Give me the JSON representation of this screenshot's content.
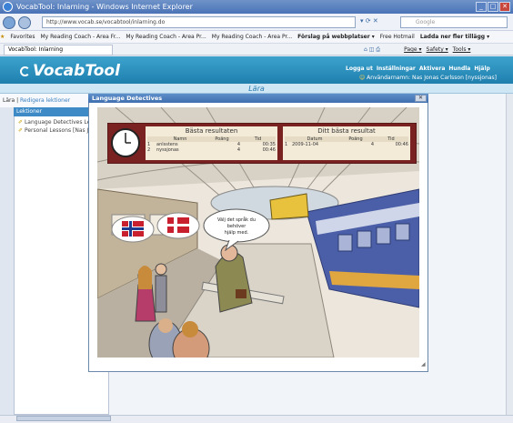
{
  "window": {
    "title": "VocabTool: Inlarning - Windows Internet Explorer"
  },
  "browser": {
    "url": "http://www.vocab.se/vocabtool/inlarning.do",
    "search_placeholder": "Google",
    "favorites_label": "Favorites",
    "favorites": [
      "My Reading Coach - Area Fr...",
      "My Reading Coach - Area Pr...",
      "My Reading Coach - Area Pr...",
      "Förslag på webbplatser ▾",
      "Free Hotmail",
      "Ladda ner fler tillägg ▾"
    ],
    "tab_title": "VocabTool: Inlarning",
    "commands": [
      "Page ▾",
      "Safety ▾",
      "Tools ▾"
    ]
  },
  "app": {
    "logo": "VocabTool",
    "nav": [
      "Logga ut",
      "Inställningar",
      "Aktivera",
      "Hundla",
      "Hjälp"
    ],
    "user_line": "Användarnamn: Nas Jonas Carlsson [nyssjonas]",
    "section_title": "Lära",
    "subnav": [
      "Lära",
      "Redigera lektioner"
    ],
    "lessons_header": "Lektioner",
    "lessons": [
      "Language Detectives Lessons",
      "Personal Lessons [Nas Jonas]"
    ]
  },
  "dialog": {
    "title": "Language Detectives",
    "close": "✕"
  },
  "scoreboard": {
    "best_title": "Bästa resultaten",
    "my_title": "Ditt bästa resultat",
    "columns": [
      "Namn",
      "Poäng",
      "Tid"
    ],
    "my_columns": [
      "Datum",
      "Poäng",
      "Tid"
    ],
    "best_rows": [
      {
        "rank": "1",
        "name": "anlsstens",
        "score": "4",
        "time": "00:35"
      },
      {
        "rank": "2",
        "name": "nyssjonas",
        "score": "4",
        "time": "00:46"
      }
    ],
    "my_rows": [
      {
        "rank": "1",
        "date": "2009-11-04",
        "score": "4",
        "time": "00:46"
      }
    ]
  },
  "speech": {
    "line1": "Välj det språk du behöver",
    "line2": "hjälp med."
  },
  "colors": {
    "header": "#2a8cbd",
    "dialog_title": "#4a7cbc",
    "board": "#8b2a2a"
  }
}
